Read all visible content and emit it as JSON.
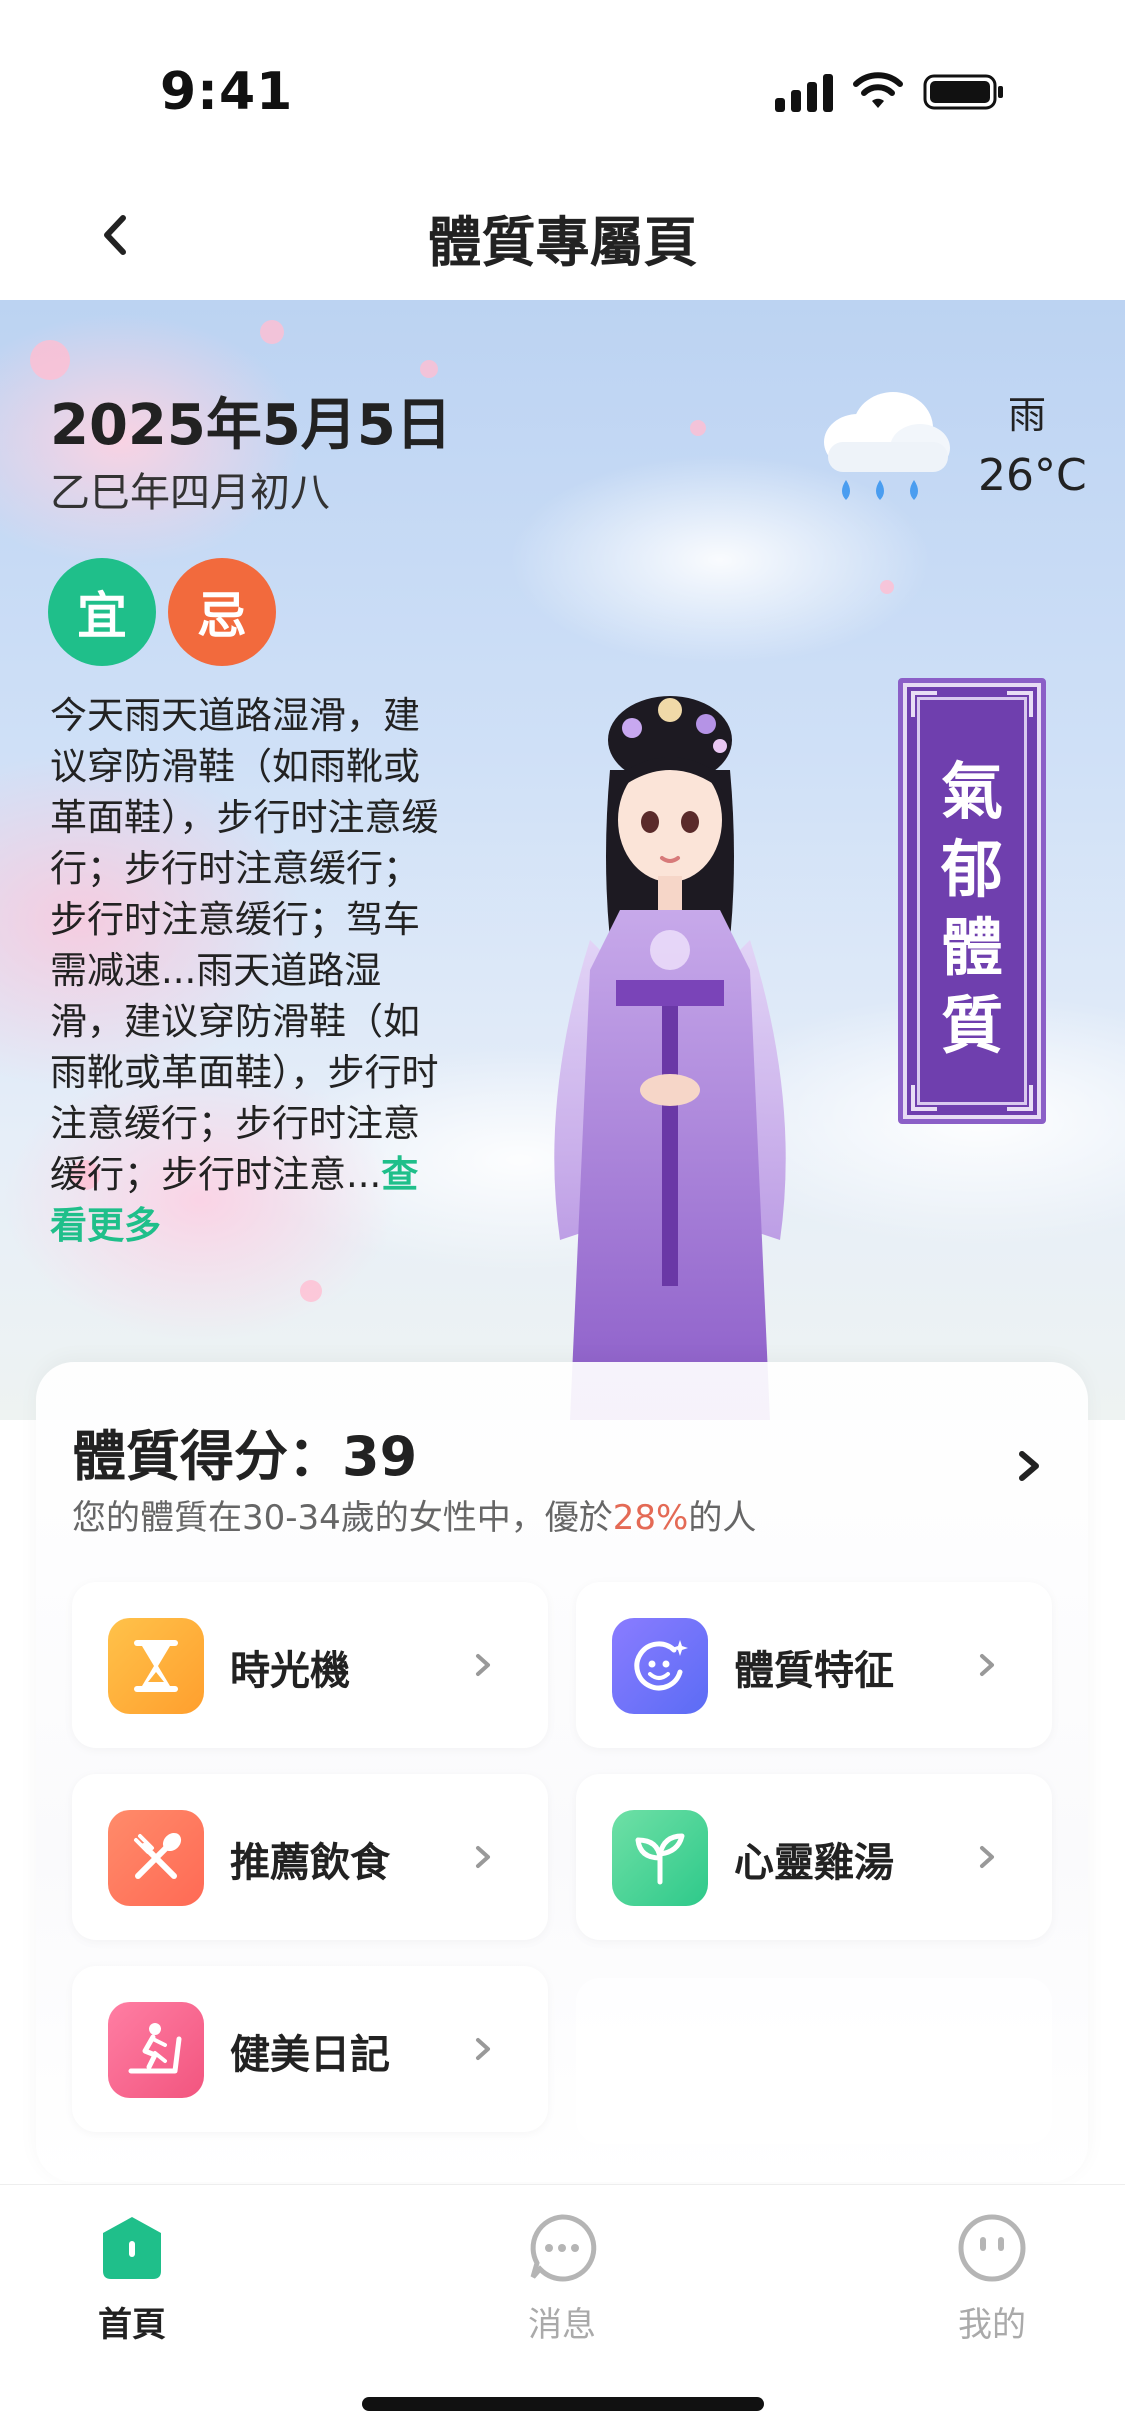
{
  "status": {
    "time": "9:41"
  },
  "nav": {
    "title": "體質專屬頁"
  },
  "hero": {
    "date": "2025年5月5日",
    "lunar": "乙巳年四月初八",
    "badge_yi": "宜",
    "badge_ji": "忌",
    "advice": "今天雨天道路湿滑，建议穿防滑鞋（如雨靴或革面鞋），步行时注意缓行；步行时注意缓行；步行时注意缓行；驾车需减速...雨天道路湿滑，建议穿防滑鞋（如雨靴或革面鞋），步行时注意缓行；步行时注意缓行；步行时注意...",
    "more": "查看更多",
    "weather": {
      "condition": "雨",
      "temp": "26°C",
      "icon": "rain-cloud-icon"
    },
    "plaque": "氣郁體質"
  },
  "score": {
    "title": "體質得分：39",
    "sub_prefix": "您的體質在30-34歲的女性中，優於",
    "sub_pct": "28%",
    "sub_suffix": "的人"
  },
  "tiles": [
    {
      "label": "時光機",
      "icon": "hourglass-icon",
      "color_a": "#ffc24a",
      "color_b": "#ff9f2e"
    },
    {
      "label": "體質特征",
      "icon": "smile-sparkle-icon",
      "color_a": "#8a7cff",
      "color_b": "#5b6cf5"
    },
    {
      "label": "推薦飲食",
      "icon": "utensils-icon",
      "color_a": "#ff8b6a",
      "color_b": "#ff6a55"
    },
    {
      "label": "心靈雞湯",
      "icon": "sprout-icon",
      "color_a": "#6fe0a6",
      "color_b": "#2ec98a"
    },
    {
      "label": "健美日記",
      "icon": "treadmill-icon",
      "color_a": "#ff7ea3",
      "color_b": "#f2557f"
    }
  ],
  "tabs": [
    {
      "label": "首頁",
      "icon": "home-icon",
      "active": true
    },
    {
      "label": "消息",
      "icon": "message-icon",
      "active": false
    },
    {
      "label": "我的",
      "icon": "profile-icon",
      "active": false
    }
  ],
  "colors": {
    "accent": "#1fbf8a",
    "ji": "#f26a3d",
    "plaque": "#6f3fae"
  }
}
